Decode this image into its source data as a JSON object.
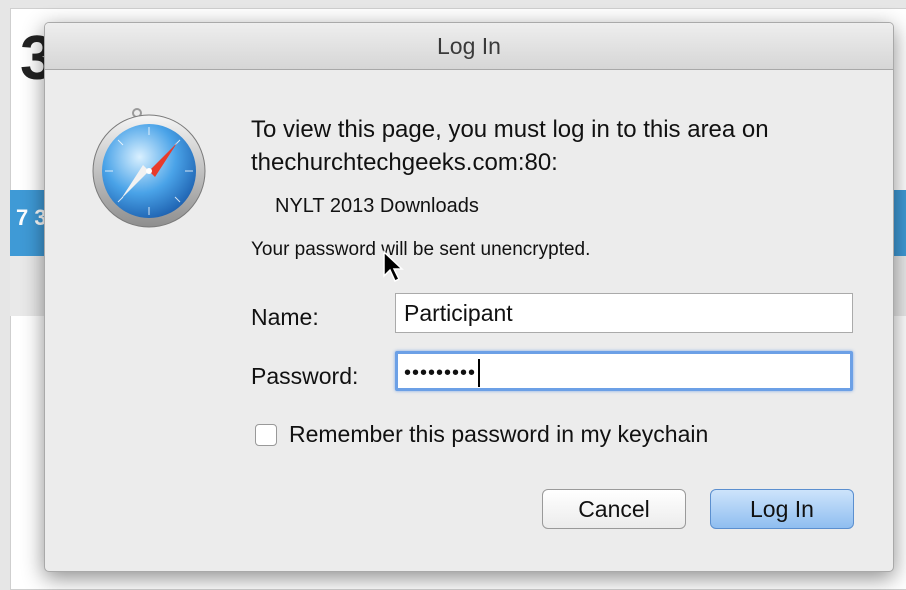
{
  "background": {
    "left_glyph": "3",
    "blue_band_glyph": "7 3"
  },
  "dialog": {
    "title": "Log In",
    "message": "To view this page, you must log in to this area on thechurchtechgeeks.com:80:",
    "realm": "NYLT 2013 Downloads",
    "warning": "Your password will be sent unencrypted.",
    "name_label": "Name:",
    "name_value": "Participant",
    "password_label": "Password:",
    "password_value": "•••••••••",
    "remember_label": "Remember this password in my keychain",
    "remember_checked": false,
    "cancel_label": "Cancel",
    "login_label": "Log In"
  },
  "icons": {
    "app_icon": "safari-compass-icon",
    "pointer": "mouse-cursor-icon"
  },
  "colors": {
    "focus_ring": "#6ca0e6",
    "default_button": "#8fbef0",
    "background_band": "#3f9ad6"
  }
}
